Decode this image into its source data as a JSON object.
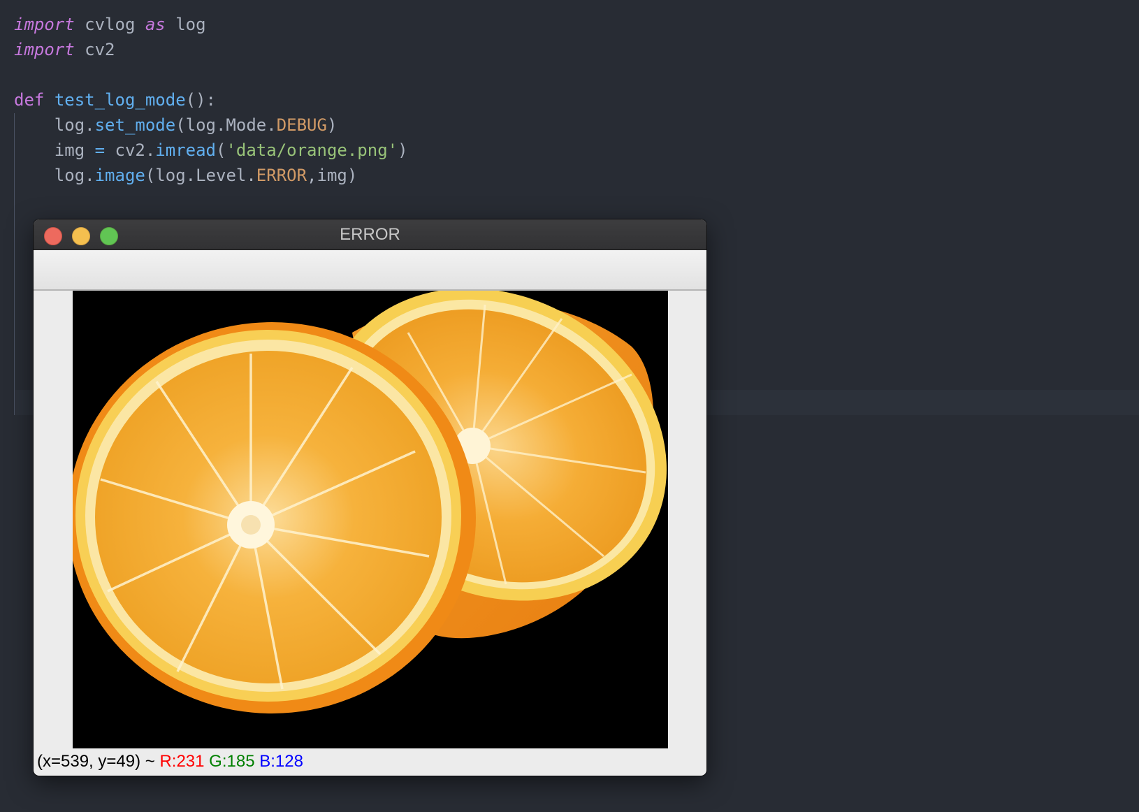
{
  "editor": {
    "lines": [
      [
        {
          "t": "import",
          "c": "kw-i"
        },
        {
          "t": " cvlog ",
          "c": ""
        },
        {
          "t": "as",
          "c": "kw-i"
        },
        {
          "t": " log",
          "c": ""
        }
      ],
      [
        {
          "t": "import",
          "c": "kw-i"
        },
        {
          "t": " cv2",
          "c": ""
        }
      ],
      [],
      [
        {
          "t": "def",
          "c": "kw"
        },
        {
          "t": " ",
          "c": ""
        },
        {
          "t": "test_log_mode",
          "c": "fn"
        },
        {
          "t": "():",
          "c": ""
        }
      ],
      [
        {
          "t": "    log.",
          "c": ""
        },
        {
          "t": "set_mode",
          "c": "fn"
        },
        {
          "t": "(log.Mode.",
          "c": ""
        },
        {
          "t": "DEBUG",
          "c": "const"
        },
        {
          "t": ")",
          "c": ""
        }
      ],
      [
        {
          "t": "    img ",
          "c": ""
        },
        {
          "t": "=",
          "c": "fn"
        },
        {
          "t": " cv2.",
          "c": ""
        },
        {
          "t": "imread",
          "c": "fn"
        },
        {
          "t": "(",
          "c": ""
        },
        {
          "t": "'data/orange.png'",
          "c": "str"
        },
        {
          "t": ")",
          "c": ""
        }
      ],
      [
        {
          "t": "    log.",
          "c": ""
        },
        {
          "t": "image",
          "c": "fn"
        },
        {
          "t": "(log.Level.",
          "c": ""
        },
        {
          "t": "ERROR",
          "c": "const"
        },
        {
          "t": ",img)",
          "c": ""
        }
      ]
    ]
  },
  "window": {
    "title": "ERROR",
    "status": {
      "coords": "(x=539, y=49) ~ ",
      "r": "R:231",
      "g": "G:185",
      "b": "B:128"
    }
  },
  "image": {
    "subject": "orange halves",
    "colors": {
      "peel": "#f08c1a",
      "flesh": "#f3a52c",
      "pith": "#fff2c2",
      "background": "#000000"
    }
  }
}
